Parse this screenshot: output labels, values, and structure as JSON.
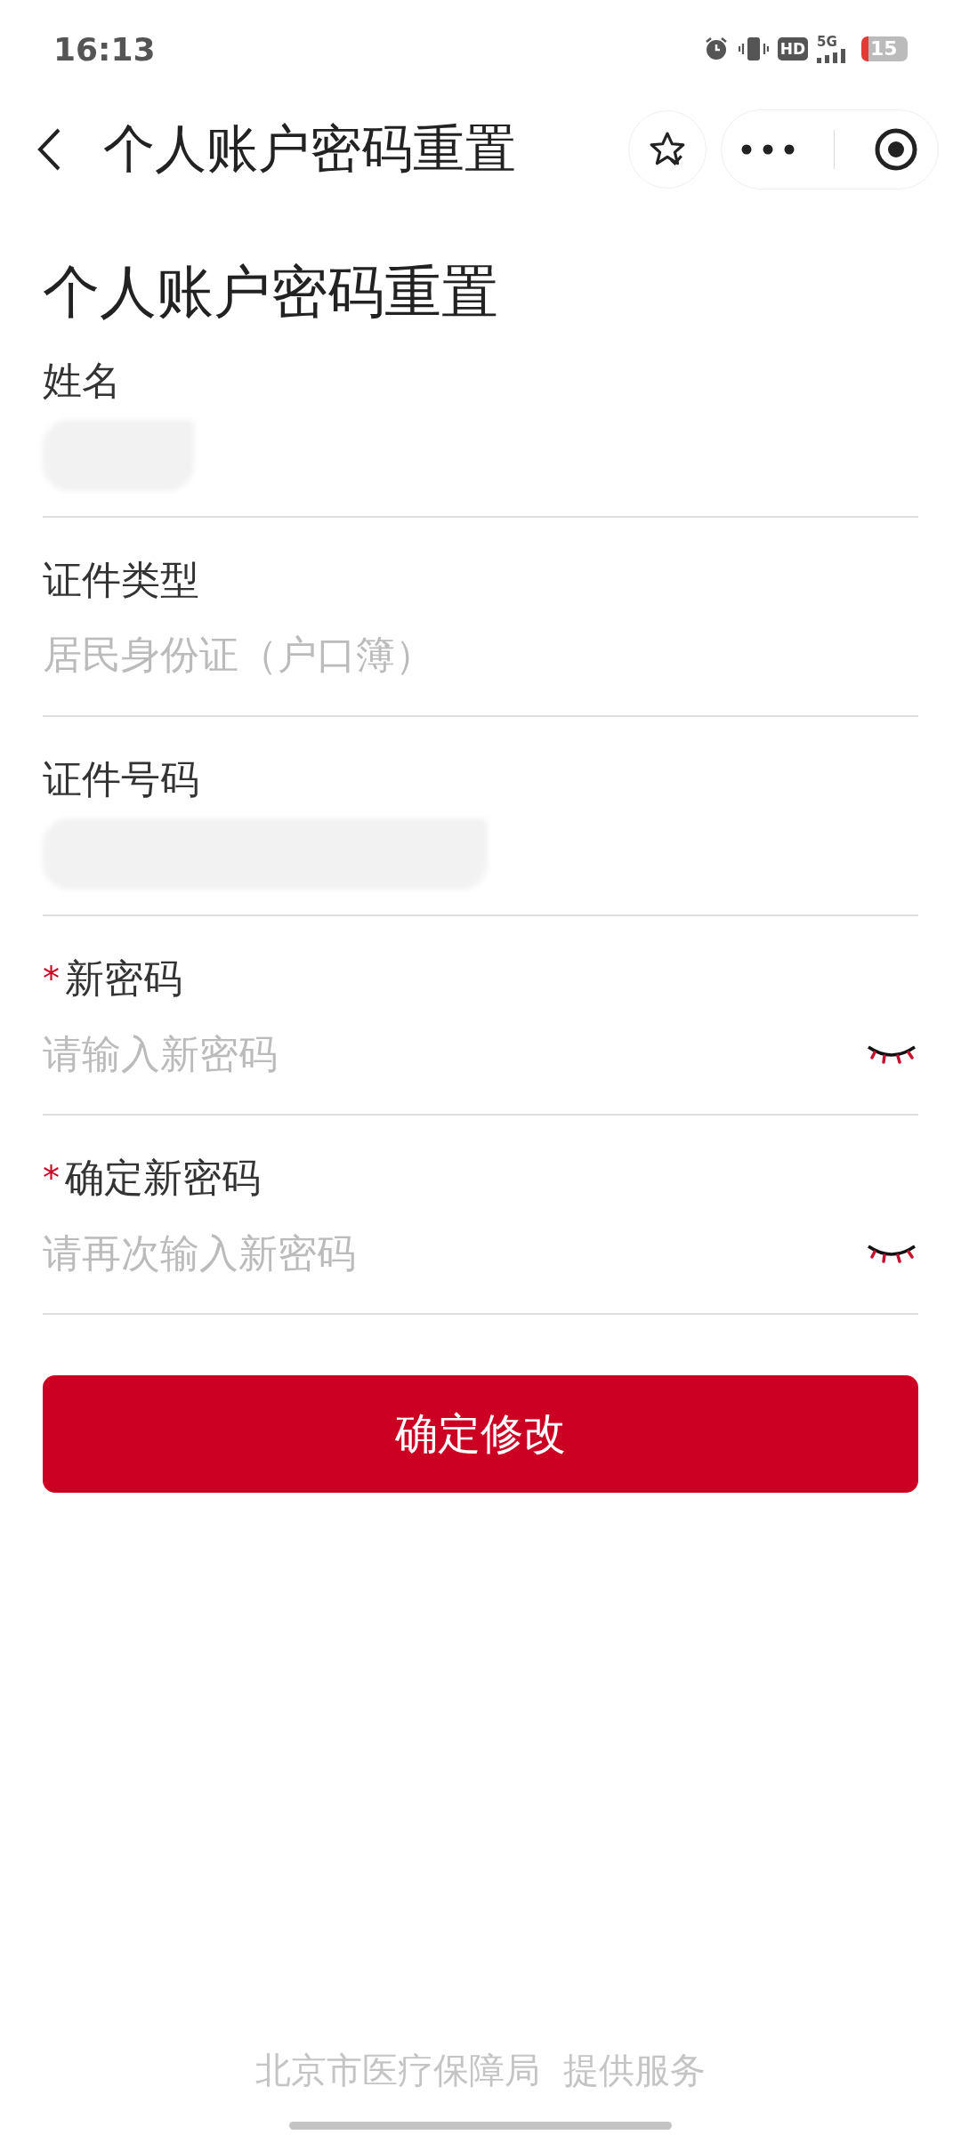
{
  "status_bar": {
    "time": "16:13",
    "hd": "HD",
    "network": "5G",
    "battery": "15"
  },
  "nav_bar": {
    "title": "个人账户密码重置"
  },
  "page": {
    "heading": "个人账户密码重置"
  },
  "fields": [
    {
      "kind": "text",
      "label": "姓名",
      "required": false,
      "redacted": true
    },
    {
      "kind": "text",
      "label": "证件类型",
      "required": false,
      "value": "居民身份证（户口簿）"
    },
    {
      "kind": "text",
      "label": "证件号码",
      "required": false,
      "redacted": true
    },
    {
      "kind": "password",
      "label": "新密码",
      "required": true,
      "required_mark": "*",
      "placeholder": "请输入新密码"
    },
    {
      "kind": "password",
      "label": "确定新密码",
      "required": true,
      "required_mark": "*",
      "placeholder": "请再次输入新密码"
    }
  ],
  "submit_button": {
    "label": "确定修改"
  },
  "footer": {
    "provider": "北京市医疗保障局",
    "suffix": "提供服务"
  }
}
